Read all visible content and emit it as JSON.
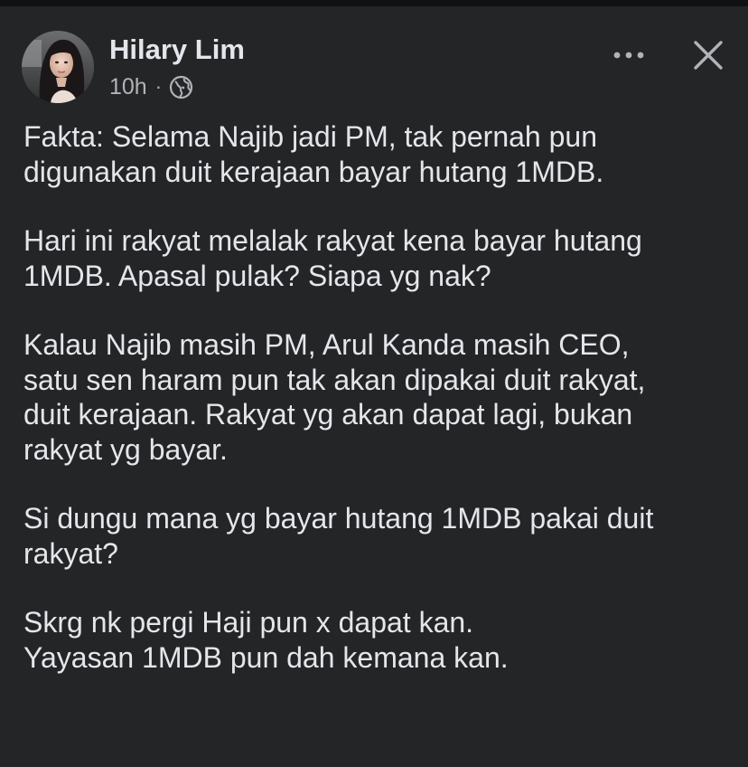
{
  "post": {
    "author": "Hilary Lim",
    "time": "10h",
    "separator": "·",
    "privacy_icon": "globe-icon",
    "more_icon": "more-horizontal-icon",
    "close_icon": "close-icon",
    "paragraphs": [
      "Fakta: Selama Najib jadi PM, tak pernah pun\ndigunakan duit kerajaan bayar hutang 1MDB.",
      "Hari ini rakyat melalak rakyat kena bayar hutang\n1MDB. Apasal pulak? Siapa yg nak?",
      "Kalau Najib masih PM, Arul Kanda masih CEO,\nsatu sen haram pun tak akan dipakai duit rakyat,\nduit kerajaan. Rakyat yg akan dapat lagi, bukan\nrakyat yg bayar.",
      "Si dungu mana yg bayar hutang 1MDB pakai duit\nrakyat?",
      "Skrg nk pergi Haji pun x dapat kan.\nYayasan 1MDB pun dah kemana kan."
    ]
  },
  "colors": {
    "background": "#242526",
    "primary_text": "#e4e6eb",
    "secondary_text": "#b0b3b8"
  }
}
